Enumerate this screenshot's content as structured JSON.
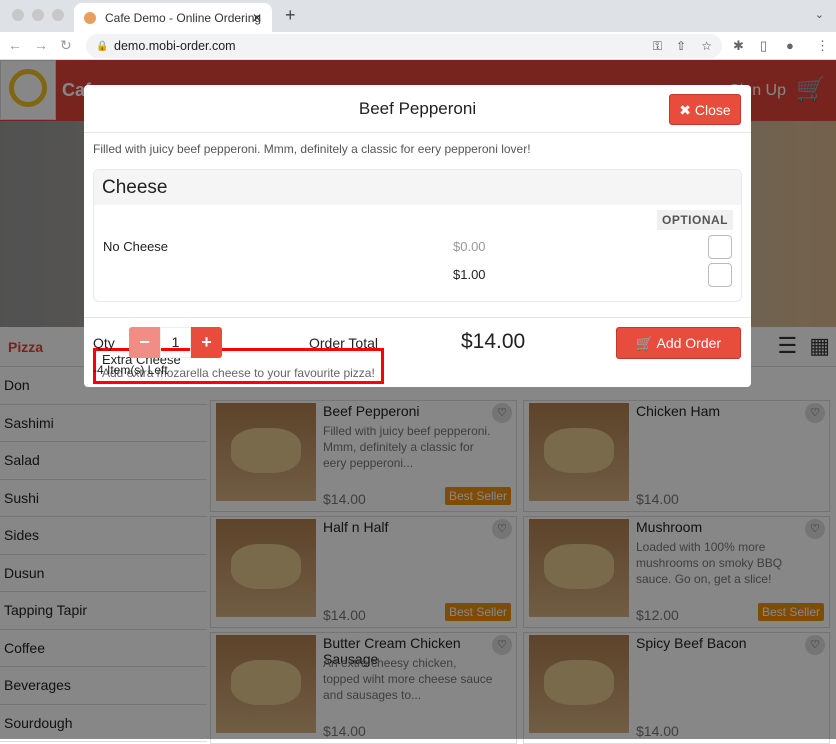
{
  "browser": {
    "tab_title": "Cafe Demo - Online Ordering",
    "url": "demo.mobi-order.com"
  },
  "header": {
    "brand": "Cafe",
    "sign_up": "Sign Up"
  },
  "categories": {
    "active": "Pizza",
    "items": [
      "Don",
      "Sashimi",
      "Salad",
      "Sushi",
      "Sides",
      "Dusun",
      "Tapping Tapir",
      "Coffee",
      "Beverages",
      "Sourdough"
    ]
  },
  "products": [
    {
      "name": "Beef Pepperoni",
      "desc": "Filled with juicy beef pepperoni. Mmm, definitely a classic for eery pepperoni...",
      "price": "$14.00",
      "badge": "Best Seller"
    },
    {
      "name": "Chicken Ham",
      "desc": "",
      "price": "$14.00",
      "badge": ""
    },
    {
      "name": "Half n Half",
      "desc": "",
      "price": "$14.00",
      "badge": "Best Seller"
    },
    {
      "name": "Mushroom",
      "desc": "Loaded with 100% more mushrooms on smoky BBQ sauce. Go on, get a slice!",
      "price": "$12.00",
      "badge": "Best Seller"
    },
    {
      "name": "Butter Cream Chicken Sausage",
      "desc": "An extra cheesy chicken, topped wiht more cheese sauce and sausages to...",
      "price": "$14.00",
      "badge": ""
    },
    {
      "name": "Spicy Beef Bacon",
      "desc": "",
      "price": "$14.00",
      "badge": ""
    }
  ],
  "modal": {
    "title": "Beef Pepperoni",
    "close": "Close",
    "description": "Filled with juicy beef pepperoni. Mmm, definitely a classic for eery pepperoni lover!",
    "group": {
      "name": "Cheese",
      "badge": "OPTIONAL",
      "options": [
        {
          "name": "No Cheese",
          "price": "$0.00",
          "checked": false
        },
        {
          "name": "Extra Cheese",
          "desc": "Add extra mozarella cheese to your favourite pizza!",
          "price": "$1.00",
          "checked": false
        }
      ]
    },
    "qty_label": "Qty",
    "qty": "1",
    "items_left": "-4 Item(s) Left",
    "order_total_label": "Order Total",
    "order_total": "$14.00",
    "add_order": "Add Order"
  },
  "colors": {
    "accent": "#e84c3d",
    "badge": "#f0900c",
    "highlight": "#ff0000"
  }
}
